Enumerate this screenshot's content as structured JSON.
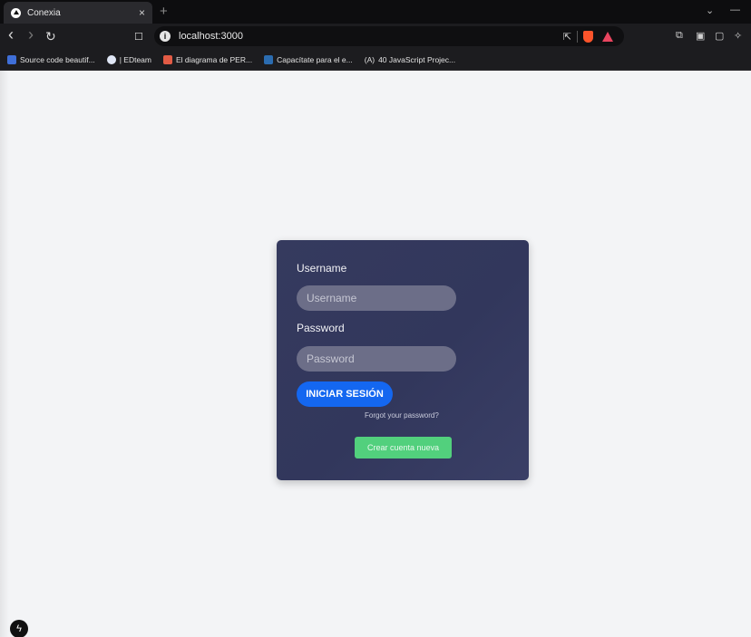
{
  "browser": {
    "tab": {
      "title": "Conexia",
      "close": "×"
    },
    "new_tab": "+",
    "window_controls": {
      "dropdown": "⌄",
      "minimize": "—"
    },
    "address": {
      "url": "localhost:3000",
      "info": "i"
    },
    "nav": {
      "back": "‹",
      "forward": "›",
      "reload": "↻",
      "bookmark": "☐"
    },
    "toolbar_icons": {
      "extensions": "⧉",
      "sidebar": "▣",
      "wallet": "▢",
      "leo": "✧",
      "share": "⇱"
    },
    "bookmarks": [
      {
        "label": "Source code beautif...",
        "color": "#3f6fd8"
      },
      {
        "label": "| EDteam",
        "color": "#dfe6f5"
      },
      {
        "label": "El diagrama de PER...",
        "color": "#e25b45"
      },
      {
        "label": "Capacítate para el e...",
        "color": "#2b6cb0"
      },
      {
        "label": "40 JavaScript Projec...",
        "color": "#444444"
      }
    ],
    "bookmark_badge": "(A)"
  },
  "login": {
    "username_label": "Username",
    "username_placeholder": "Username",
    "password_label": "Password",
    "password_placeholder": "Password",
    "login_button": "INICIAR SESIÓN",
    "forgot_link": "Forgot your password?",
    "create_button": "Crear cuenta nueva"
  },
  "next_indicator": "ϟ",
  "colors": {
    "card_bg": "#353a5e",
    "primary_button": "#1467f0",
    "create_button": "#52d07d",
    "page_bg": "#f3f4f6"
  }
}
